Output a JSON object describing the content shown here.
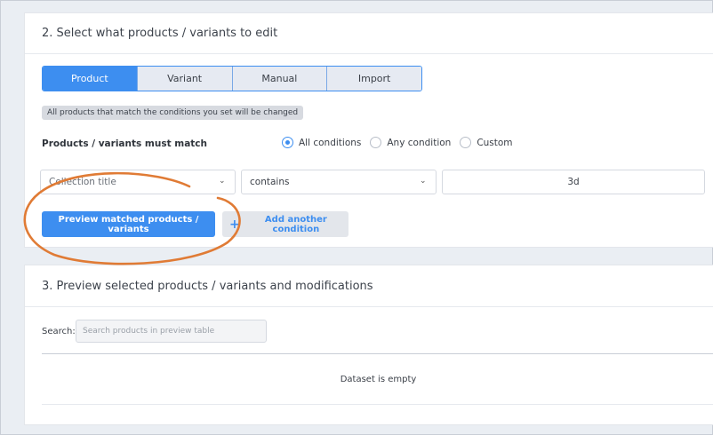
{
  "section2": {
    "title": "2. Select what products / variants to edit",
    "tabs": [
      {
        "label": "Product",
        "active": true
      },
      {
        "label": "Variant",
        "active": false
      },
      {
        "label": "Manual",
        "active": false
      },
      {
        "label": "Import",
        "active": false
      }
    ],
    "note": "All products that match the conditions you set will be changed",
    "match_label": "Products / variants must match",
    "match_options": [
      {
        "label": "All conditions",
        "checked": true
      },
      {
        "label": "Any condition",
        "checked": false
      },
      {
        "label": "Custom",
        "checked": false
      }
    ],
    "condition": {
      "field": "Collection title",
      "operator": "contains",
      "value": "3d"
    },
    "preview_button": "Preview matched products / variants",
    "add_condition_button": "Add another condition"
  },
  "section3": {
    "title": "3. Preview selected products / variants and modifications",
    "search_label": "Search:",
    "search_placeholder": "Search products in preview table",
    "empty_text": "Dataset is empty"
  },
  "colors": {
    "accent": "#3d8ef0",
    "annotation": "#e07b35"
  },
  "icons": {
    "chevron": "chevron-down-icon",
    "plus": "plus-icon"
  }
}
